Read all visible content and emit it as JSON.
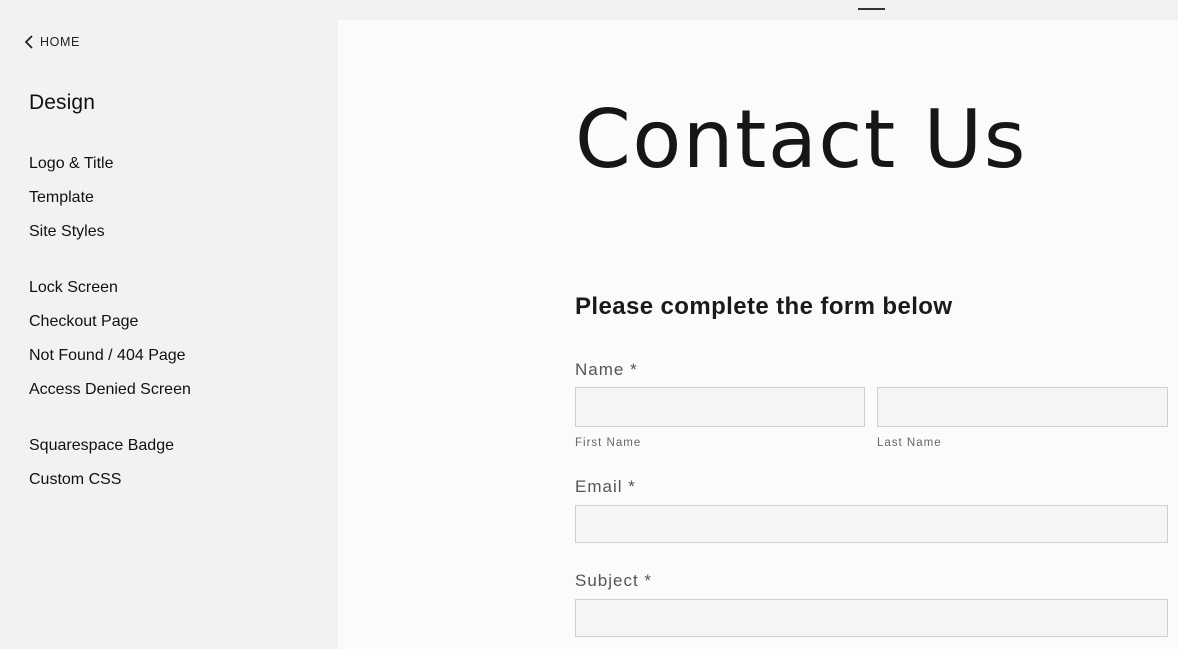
{
  "sidebar": {
    "back_label": "HOME",
    "title": "Design",
    "groups": [
      [
        "Logo & Title",
        "Template",
        "Site Styles"
      ],
      [
        "Lock Screen",
        "Checkout Page",
        "Not Found / 404 Page",
        "Access Denied Screen"
      ],
      [
        "Squarespace Badge",
        "Custom CSS"
      ]
    ]
  },
  "preview": {
    "page_title": "Contact Us",
    "form_heading": "Please complete the form below",
    "fields": {
      "name_label": "Name *",
      "first_name_label": "First Name",
      "first_name_value": "",
      "last_name_label": "Last Name",
      "last_name_value": "",
      "email_label": "Email *",
      "email_value": "",
      "subject_label": "Subject *",
      "subject_value": ""
    }
  }
}
